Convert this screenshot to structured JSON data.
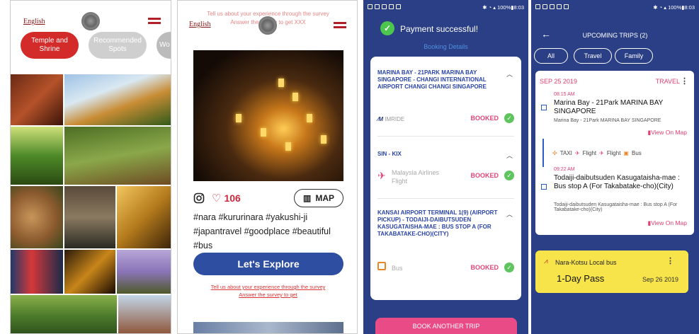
{
  "panel1": {
    "language": "English",
    "pills": [
      {
        "label": "Temple and Shrine",
        "bg": "#d32a2a"
      },
      {
        "label": "Recommended Spots",
        "bg": "#cfcfcf"
      },
      {
        "label": "Wo",
        "bg": "#cfcfcf"
      }
    ]
  },
  "panel2": {
    "survey_top_line1": "Tell us about your experience through the survey",
    "survey_top_line2": "Answer the survey to get XXX",
    "language": "English",
    "likes": "106",
    "map_label": "MAP",
    "hashtags": "#nara #kururinara #yakushi-ji #japantravel #goodplace #beautiful #bus",
    "explore_label": "Let's Explore",
    "survey_bottom_line1": "Tell us about your experience through the survey",
    "survey_bottom_line2": "Answer the survey to get"
  },
  "status_bar": {
    "battery": "100%",
    "time": "8:03"
  },
  "panel3": {
    "title": "Payment successful!",
    "booking_details": "Booking Details",
    "segments": [
      {
        "title": "MARINA BAY - 21PARK MARINA BAY SINGAPORE - CHANGI INTERNATIONAL AIRPORT  CHANGI CHANGI SINGAPORE",
        "provider": "IMRIDE",
        "status": "BOOKED"
      },
      {
        "title": "SIN - KIX",
        "provider": "Malaysia Airlines Flight",
        "status": "BOOKED"
      },
      {
        "title": "KANSAI AIRPORT TERMINAL 1(9) (AIRPORT PICKUP) - TODAIJI-DAIBUTSUDEN KASUGATAISHA-MAE : BUS STOP A (FOR TAKABATAKE-CHO)(CITY)",
        "provider": "Bus",
        "status": "BOOKED"
      }
    ],
    "book_another": "BOOK ANOTHER TRIP"
  },
  "panel4": {
    "title": "UPCOMING TRIPS (2)",
    "filters": [
      "All",
      "Travel",
      "Family"
    ],
    "trip": {
      "date": "SEP 25 2019",
      "tag": "TRAVEL",
      "stop1_time": "08:15 AM",
      "stop1_name": "Marina Bay - 21Park MARINA BAY SINGAPORE",
      "stop1_sub": "Marina Bay - 21Park MARINA BAY SINGAPORE",
      "view_map": "View On Map",
      "modes": [
        "TAXI",
        "Flight",
        "Flight",
        "Bus"
      ],
      "stop2_time": "09:22 AM",
      "stop2_name": "Todaiji-daibutsuden Kasugataisha-mae : Bus stop A (For Takabatake-cho)(City)",
      "stop2_sub": "Todaiji-daibutsuden Kasugataisha-mae : Bus stop A (For Takabatake-cho)(City)"
    },
    "pass": {
      "operator": "Nara-Kotsu Local bus",
      "name": "1-Day Pass",
      "date": "Sep 26 2019"
    }
  }
}
